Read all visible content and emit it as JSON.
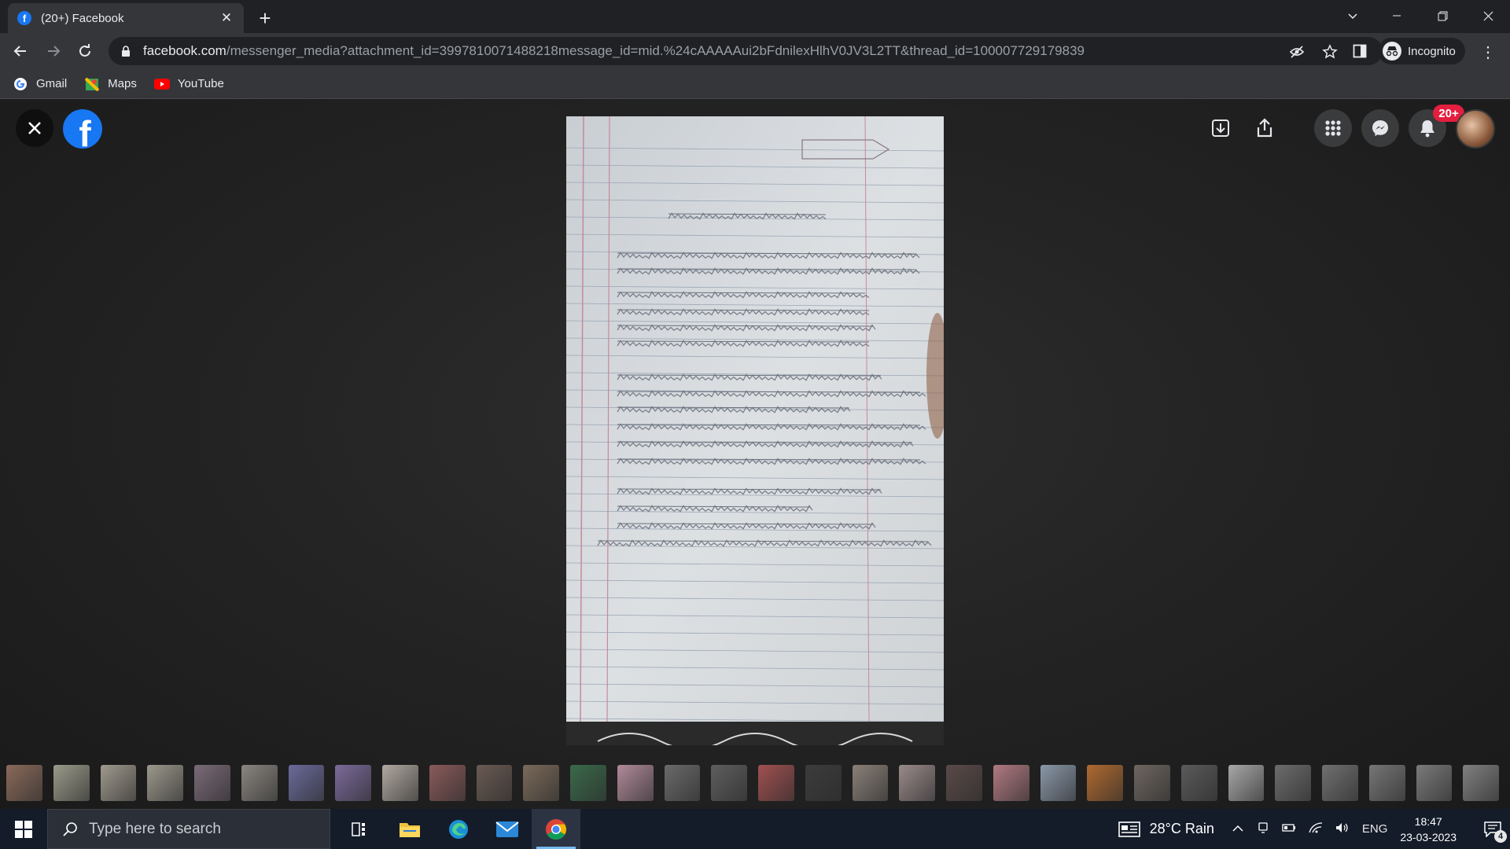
{
  "browser": {
    "tab_title": "(20+) Facebook",
    "url_host": "facebook.com",
    "url_path": "/messenger_media?attachment_id=3997810071488218message_id=mid.%24cAAAAAui2bFdnilexHlhV0JV3L2TT&thread_id=100007729179839",
    "incognito_label": "Incognito",
    "bookmarks": [
      {
        "label": "Gmail",
        "icon": "google-icon"
      },
      {
        "label": "Maps",
        "icon": "maps-icon"
      },
      {
        "label": "YouTube",
        "icon": "youtube-icon"
      }
    ]
  },
  "facebook": {
    "notification_badge": "20+",
    "thumbnail_count": 32
  },
  "taskbar": {
    "search_placeholder": "Type here to search",
    "weather": "28°C  Rain",
    "language": "ENG",
    "time": "18:47",
    "date": "23-03-2023",
    "notification_count": "4"
  },
  "colors": {
    "facebook_blue": "#1877f2",
    "badge_red": "#e41e3f",
    "chrome_dark": "#202124",
    "chrome_toolbar": "#35363a"
  }
}
